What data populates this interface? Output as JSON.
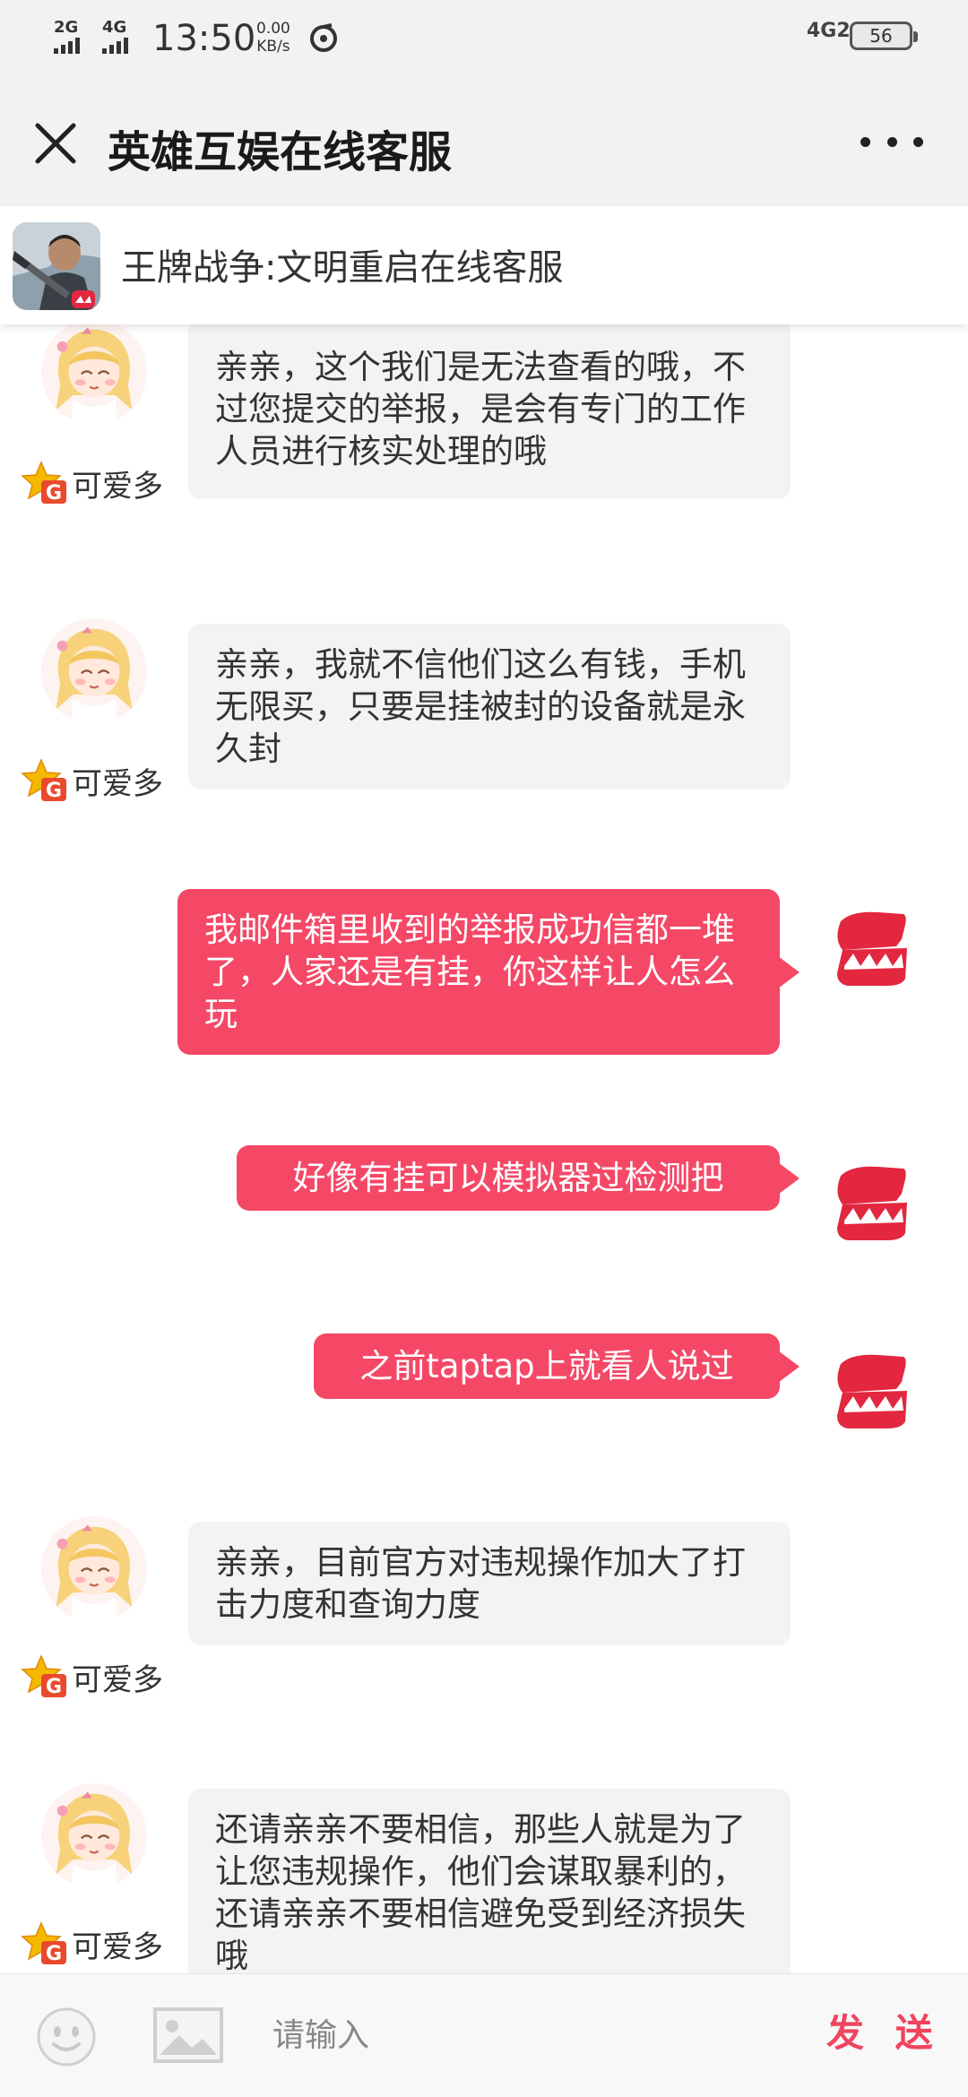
{
  "status_bar": {
    "signal1": "2G",
    "signal2": "4G",
    "time": "13:50",
    "speed_value": "0.00",
    "speed_unit": "KB/s",
    "network": "4G2",
    "battery": "56"
  },
  "header": {
    "title": "英雄互娱在线客服"
  },
  "game": {
    "name": "王牌战争:文明重启在线客服"
  },
  "agent_name": "可爱多",
  "messages": [
    {
      "from": "agent",
      "text": "亲亲，这个我们是无法查看的哦，不过您提交的举报，是会有专门的工作人员进行核实处理的哦"
    },
    {
      "from": "agent",
      "text": "亲亲，我就不信他们这么有钱，手机无限买，只要是挂被封的设备就是永久封"
    },
    {
      "from": "user",
      "text": "我邮件箱里收到的举报成功信都一堆了，人家还是有挂，你这样让人怎么玩"
    },
    {
      "from": "user",
      "text": "好像有挂可以模拟器过检测把"
    },
    {
      "from": "user",
      "text": "之前taptap上就看人说过"
    },
    {
      "from": "agent",
      "text": "亲亲，目前官方对违规操作加大了打击力度和查询力度"
    },
    {
      "from": "agent",
      "text": "还请亲亲不要相信，那些人就是为了让您违规操作，他们会谋取暴利的，还请亲亲不要相信避免受到经济损失哦"
    }
  ],
  "input": {
    "placeholder": "请输入",
    "send_label": "发 送"
  },
  "colors": {
    "accent": "#f54867",
    "send": "#f0445f",
    "agent_bubble": "#f3f3f4",
    "header_bg": "#f2f2f2"
  },
  "icons": [
    "close-icon",
    "more-icon",
    "game-app-icon",
    "agent-avatar",
    "vip-badge-icon",
    "user-logo-icon",
    "emoji-icon",
    "image-icon"
  ]
}
